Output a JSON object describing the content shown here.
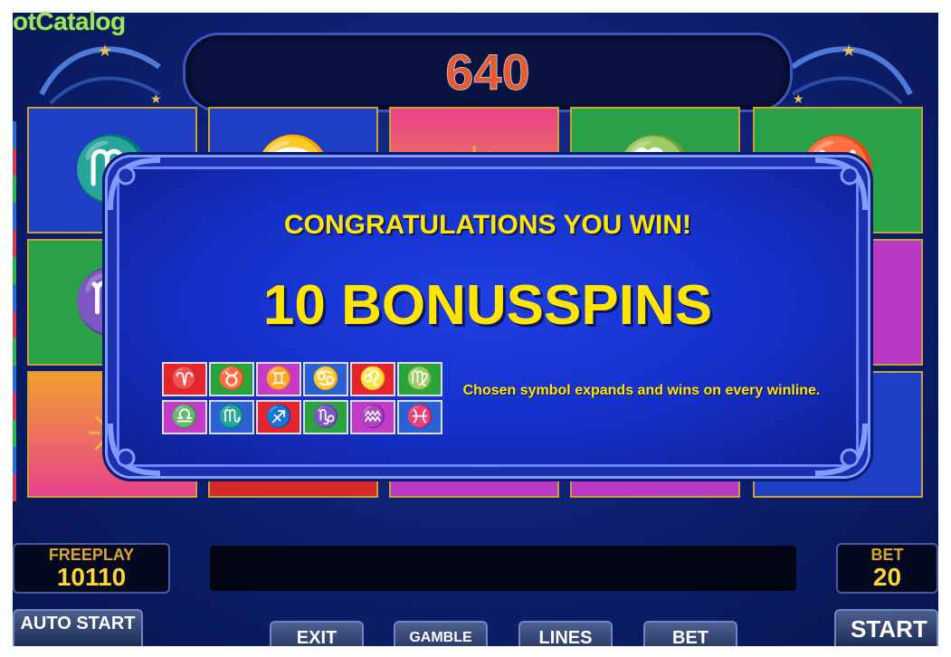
{
  "watermark": "otCatalog",
  "top_display": {
    "value": "640"
  },
  "popup": {
    "title": "CONGRATULATIONS YOU WIN!",
    "headline": "10 BONUSSPINS",
    "description": "Chosen symbol expands and wins on every winline.",
    "symbols": [
      {
        "name": "aries-icon",
        "glyph": "♈",
        "bg": "#e6242b"
      },
      {
        "name": "taurus-icon",
        "glyph": "♉",
        "bg": "#29a33a"
      },
      {
        "name": "gemini-icon",
        "glyph": "♊",
        "bg": "#c43ac9"
      },
      {
        "name": "cancer-icon",
        "glyph": "♋",
        "bg": "#2a62d6"
      },
      {
        "name": "leo-icon",
        "glyph": "♌",
        "bg": "#e6242b"
      },
      {
        "name": "virgo-icon",
        "glyph": "♍",
        "bg": "#29a33a"
      },
      {
        "name": "libra-icon",
        "glyph": "♎",
        "bg": "#c43ac9"
      },
      {
        "name": "scorpio-icon",
        "glyph": "♏",
        "bg": "#2a62d6"
      },
      {
        "name": "sagittarius-icon",
        "glyph": "♐",
        "bg": "#e6242b"
      },
      {
        "name": "capricorn-icon",
        "glyph": "♑",
        "bg": "#29a33a"
      },
      {
        "name": "aquarius-icon",
        "glyph": "♒",
        "bg": "#c43ac9"
      },
      {
        "name": "pisces-icon",
        "glyph": "♓",
        "bg": "#2a62d6"
      }
    ]
  },
  "freeplay": {
    "label": "FREEPLAY",
    "value": "10110"
  },
  "bet_display": {
    "label": "BET",
    "value": "20"
  },
  "buttons": {
    "auto_start": "AUTO START",
    "exit": "EXIT",
    "gamble": "GAMBLE",
    "lines": "LINES",
    "bet": "BET",
    "start": "START"
  },
  "colors": {
    "accent_yellow": "#ffe600",
    "credit_orange": "#e85a2a",
    "frame_gold": "#c7a23a"
  }
}
